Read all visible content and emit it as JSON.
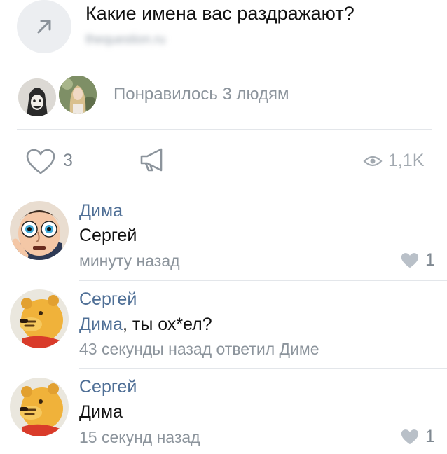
{
  "shared_post": {
    "title": "Какие имена вас раздражают?",
    "domain": "thequestion.ru",
    "icon": "arrow-up-right-icon"
  },
  "likes_row": {
    "text": "Понравилось 3 людям"
  },
  "actions": {
    "like_count": "3",
    "views": "1,1K"
  },
  "comments": [
    {
      "author": "Дима",
      "text": "Сергей",
      "time": "минуту назад",
      "likes": "1"
    },
    {
      "author": "Сергей",
      "mention": "Дима",
      "text_rest": ", ты ох*ел?",
      "time": "43 секунды назад ответил Диме"
    },
    {
      "author": "Сергей",
      "text": "Дима",
      "time": "15 секунд назад",
      "likes": "1"
    }
  ],
  "colors": {
    "link": "#4f6f96",
    "muted": "#8c949c",
    "heart_filled": "#b9c0c8",
    "divider": "#e3e6ea"
  }
}
